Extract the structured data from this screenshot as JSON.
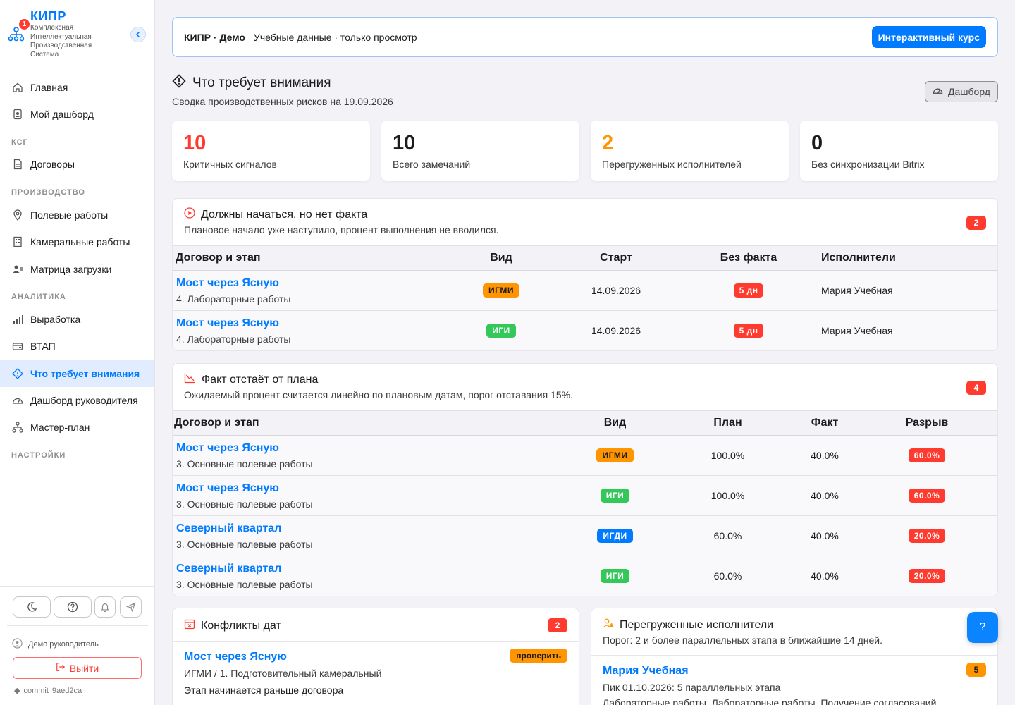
{
  "brand": {
    "name": "КИПР",
    "badge": "1",
    "subtitle": "Комплексная Интеллектуальная Производственная Система"
  },
  "sidebar": {
    "items": [
      {
        "label": "Главная",
        "icon": "home-icon"
      },
      {
        "label": "Мой дашборд",
        "icon": "dashboard-icon"
      },
      {
        "label": "Договоры",
        "icon": "document-icon"
      },
      {
        "label": "Полевые работы",
        "icon": "map-pin-icon"
      },
      {
        "label": "Камеральные работы",
        "icon": "building-icon"
      },
      {
        "label": "Матрица загрузки",
        "icon": "users-icon"
      },
      {
        "label": "Выработка",
        "icon": "bar-chart-icon"
      },
      {
        "label": "ВТАП",
        "icon": "wallet-icon"
      },
      {
        "label": "Что требует внимания",
        "icon": "warning-diamond-icon"
      },
      {
        "label": "Дашборд руководителя",
        "icon": "gauge-icon"
      },
      {
        "label": "Мастер-план",
        "icon": "hierarchy-icon"
      }
    ],
    "sections": [
      "КСГ",
      "ПРОИЗВОДСТВО",
      "АНАЛИТИКА",
      "НАСТРОЙКИ"
    ],
    "user": "Демо руководитель",
    "logout": "Выйти",
    "commit_label": "commit",
    "commit_hash": "9aed2ca"
  },
  "banner": {
    "title": "КИПР · Демо",
    "text": "Учебные данные · только просмотр",
    "button": "Интерактивный курс"
  },
  "page": {
    "title": "Что требует внимания",
    "subtitle": "Сводка производственных рисков на 19.09.2026",
    "dashboard_button": "Дашборд"
  },
  "kpis": [
    {
      "value": "10",
      "label": "Критичных сигналов",
      "color": "#ff3b30"
    },
    {
      "value": "10",
      "label": "Всего замечаний",
      "color": "#1c1c1e"
    },
    {
      "value": "2",
      "label": "Перегруженных исполнителей",
      "color": "#ff9500"
    },
    {
      "value": "0",
      "label": "Без синхронизации Bitrix",
      "color": "#1c1c1e"
    }
  ],
  "no_fact": {
    "title": "Должны начаться, но нет факта",
    "desc": "Плановое начало уже наступило, процент выполнения не вводился.",
    "count": "2",
    "headers": [
      "Договор и этап",
      "Вид",
      "Старт",
      "Без факта",
      "Исполнители"
    ],
    "rows": [
      {
        "name": "Мост через Ясную",
        "stage": "4. Лабораторные работы",
        "kind": "ИГМИ",
        "start": "14.09.2026",
        "delay": "5 дн",
        "executor": "Мария Учебная"
      },
      {
        "name": "Мост через Ясную",
        "stage": "4. Лабораторные работы",
        "kind": "ИГИ",
        "start": "14.09.2026",
        "delay": "5 дн",
        "executor": "Мария Учебная"
      }
    ]
  },
  "behind": {
    "title": "Факт отстаёт от плана",
    "desc": "Ожидаемый процент считается линейно по плановым датам, порог отставания 15%.",
    "count": "4",
    "headers": [
      "Договор и этап",
      "Вид",
      "План",
      "Факт",
      "Разрыв"
    ],
    "rows": [
      {
        "name": "Мост через Ясную",
        "stage": "3. Основные полевые работы",
        "kind": "ИГМИ",
        "plan": "100.0%",
        "fact": "40.0%",
        "gap": "60.0%"
      },
      {
        "name": "Мост через Ясную",
        "stage": "3. Основные полевые работы",
        "kind": "ИГИ",
        "plan": "100.0%",
        "fact": "40.0%",
        "gap": "60.0%"
      },
      {
        "name": "Северный квартал",
        "stage": "3. Основные полевые работы",
        "kind": "ИГДИ",
        "plan": "60.0%",
        "fact": "40.0%",
        "gap": "20.0%"
      },
      {
        "name": "Северный квартал",
        "stage": "3. Основные полевые работы",
        "kind": "ИГИ",
        "plan": "60.0%",
        "fact": "40.0%",
        "gap": "20.0%"
      }
    ]
  },
  "conflicts": {
    "title": "Конфликты дат",
    "count": "2",
    "item": {
      "name": "Мост через Ясную",
      "stage": "ИГМИ / 1. Подготовительный камеральный",
      "note": "Этап начинается раньше договора",
      "pill": "проверить"
    }
  },
  "overloaded": {
    "title": "Перегруженные исполнители",
    "desc": "Порог: 2 и более параллельных этапа в ближайшие 14 дней.",
    "item": {
      "name": "Мария Учебная",
      "peak": "Пик 01.10.2026: 5 параллельных этапа",
      "list": "Лабораторные работы, Лабораторные работы, Получение согласований",
      "count": "5"
    }
  },
  "help": "?"
}
